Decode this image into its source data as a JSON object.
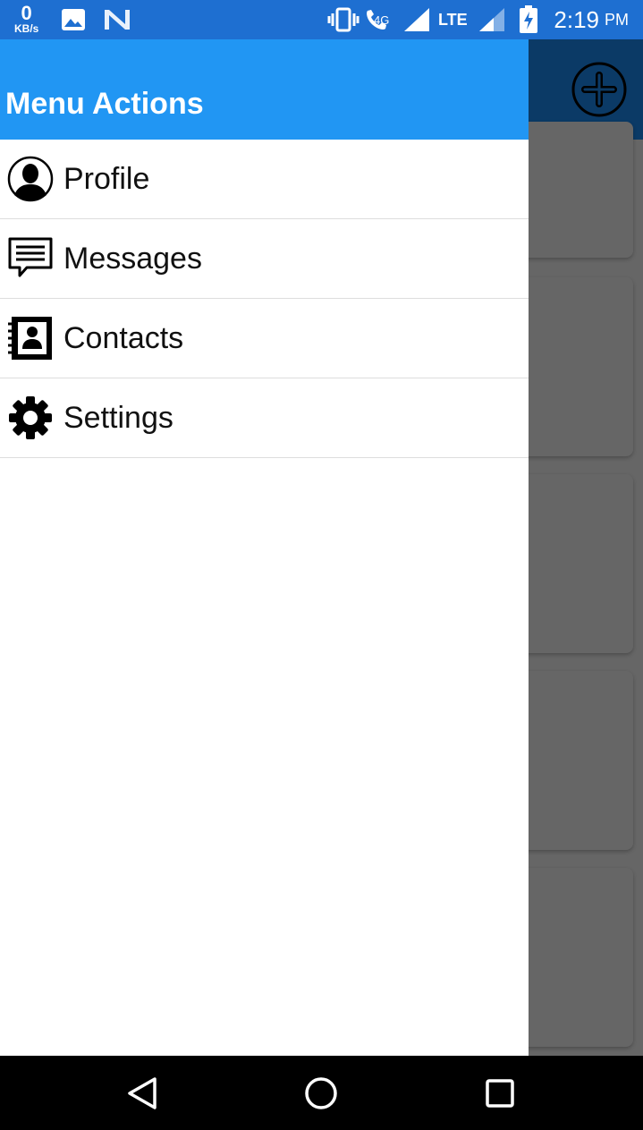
{
  "status_bar": {
    "net_speed_value": "0",
    "net_speed_unit": "KB/s",
    "network_4g": "4G",
    "network_type": "LTE",
    "time": "2:19",
    "am_pm": "PM",
    "icons": [
      "image-icon",
      "n-app-icon",
      "vibrate-icon",
      "wifi-calling-icon",
      "signal-icon",
      "signal-icon-2",
      "battery-charging-icon"
    ]
  },
  "drawer": {
    "title": "Menu Actions",
    "items": [
      {
        "label": "Profile",
        "icon": "profile-icon"
      },
      {
        "label": "Messages",
        "icon": "messages-icon"
      },
      {
        "label": "Contacts",
        "icon": "contacts-icon"
      },
      {
        "label": "Settings",
        "icon": "settings-icon"
      }
    ]
  },
  "app_bar": {
    "add_icon": "add-circle-icon"
  },
  "nav_bar": {
    "icons": [
      "back-icon",
      "home-icon",
      "recents-icon"
    ]
  },
  "colors": {
    "status_bar": "#1E6FD1",
    "drawer_header": "#2196F3",
    "app_bar_dimmed": "#0B3A66",
    "scrim": "#666666"
  }
}
